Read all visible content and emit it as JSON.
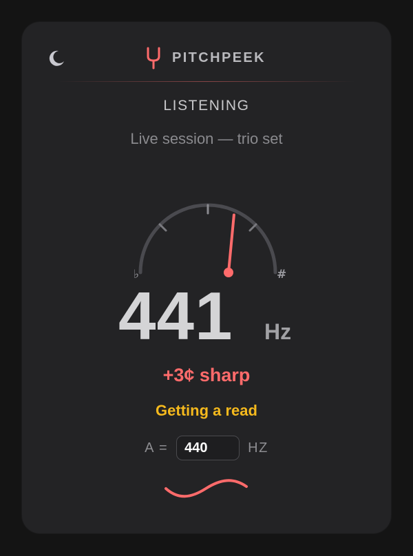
{
  "app": {
    "name": "PITCHPEEK",
    "theme_icon": "moon-icon",
    "logo_icon": "tuning-fork-icon"
  },
  "status": {
    "label": "LISTENING",
    "session": "Live session — trio set"
  },
  "meter": {
    "flat_symbol": "♭",
    "sharp_symbol": "#",
    "needle_cents": 3
  },
  "reading": {
    "frequency": "441",
    "unit": "Hz",
    "deviation": "+3¢ sharp",
    "confidence": "Getting a read"
  },
  "reference": {
    "prefix": "A =",
    "value": "440",
    "unit": "HZ"
  },
  "colors": {
    "accent": "#ff6b6b",
    "warning": "#f5b91d",
    "card": "#232325",
    "background": "#141414"
  }
}
